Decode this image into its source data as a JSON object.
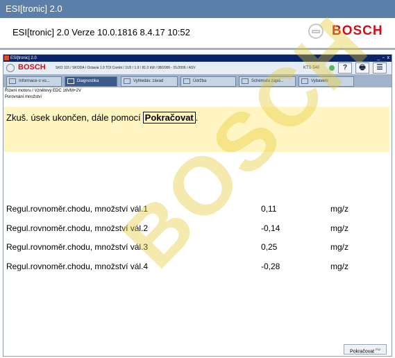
{
  "app": {
    "window_title": "ESI[tronic] 2.0",
    "header_title": "ESI[tronic] 2.0  Verze 10.0.1816  8.4.17  10:52",
    "brand": "BOSCH"
  },
  "inner_window": {
    "title": "ESI[tronic] 2.0",
    "controls": "_ ▫ x"
  },
  "subbar": {
    "brand": "BOSCH",
    "vehicle": "SKO 115 / SKODA / Octavia 1.9 TDI Combi / 1U5 / 1.9 / 81.0 kW / 08/2000 - 01/2006 / ASV",
    "device": "KTS 540",
    "help": "?",
    "print": "🖶",
    "menu": "☰"
  },
  "tabs": [
    {
      "label": "Informace o vo...",
      "icon": "car-info-icon"
    },
    {
      "label": "Diagnostika",
      "icon": "diagnostics-icon"
    },
    {
      "label": "Vyhledáv. závad",
      "icon": "troubleshooting-icon"
    },
    {
      "label": "Údržba",
      "icon": "maintenance-icon"
    },
    {
      "label": "Schémata zapo...",
      "icon": "wiring-icon"
    },
    {
      "label": "Vybavení",
      "icon": "equipment-icon"
    }
  ],
  "breadcrumb": {
    "line1": "Řízení motoru / Vznětový EDC 16VM+2V",
    "line2": "Porovnání množství"
  },
  "message": {
    "text": "Zkuš. úsek ukončen, dále pomocí",
    "key": "Pokračovat",
    "suffix": "."
  },
  "rows": [
    {
      "label": "Regul.rovnoměr.chodu, množství vál.1",
      "value": "0,11",
      "unit": "mg/z"
    },
    {
      "label": "Regul.rovnoměr.chodu, množství vál.2",
      "value": "-0,14",
      "unit": "mg/z"
    },
    {
      "label": "Regul.rovnoměr.chodu, množství vál.3",
      "value": "0,25",
      "unit": "mg/z"
    },
    {
      "label": "Regul.rovnoměr.chodu, množství vál.4",
      "value": "-0,28",
      "unit": "mg/z"
    }
  ],
  "footer": {
    "continue_button": "Pokračovat",
    "continue_key": "F12"
  },
  "colors": {
    "brand_red": "#d40f14",
    "message_bg": "#fff6c4",
    "title_bar": "#5b7fa8"
  }
}
